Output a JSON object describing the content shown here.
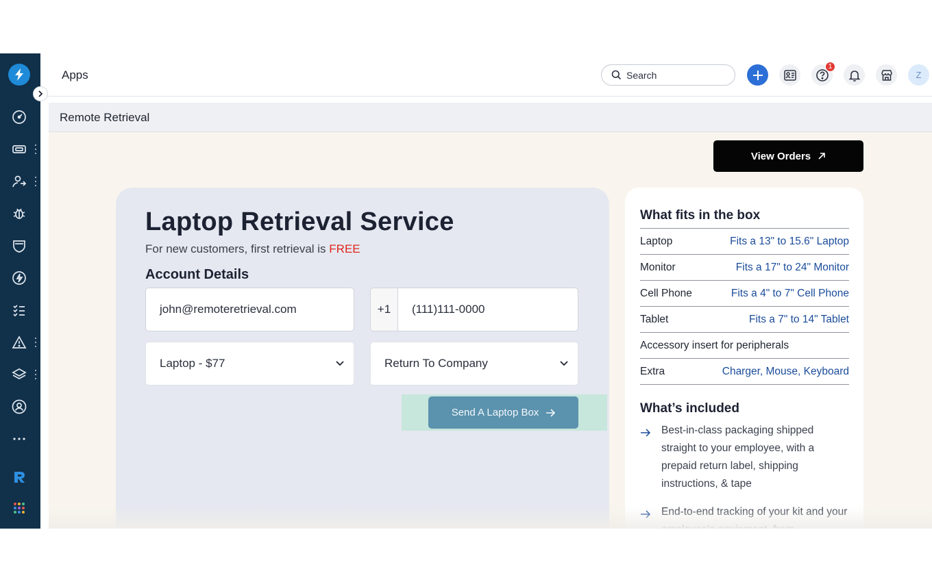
{
  "topbar": {
    "title": "Apps",
    "search_placeholder": "Search",
    "help_badge": "1",
    "avatar_initial": "Z"
  },
  "sidebar": {
    "items": [
      {
        "icon": "dashboard-icon"
      },
      {
        "icon": "ticket-icon",
        "more": true
      },
      {
        "icon": "contacts-icon",
        "more": true
      },
      {
        "icon": "bug-icon"
      },
      {
        "icon": "shield-icon"
      },
      {
        "icon": "lightning-icon"
      },
      {
        "icon": "checklist-icon"
      },
      {
        "icon": "alert-icon",
        "more": true
      },
      {
        "icon": "layers-icon",
        "more": true
      },
      {
        "icon": "admin-icon"
      },
      {
        "icon": "more-icon"
      },
      {
        "icon": "remote-retrieval-app-icon"
      },
      {
        "icon": "apps-grid-icon"
      }
    ]
  },
  "page": {
    "title": "Remote Retrieval",
    "view_orders_label": "View Orders"
  },
  "main_card": {
    "title": "Laptop Retrieval Service",
    "subtitle_prefix": "For new customers, first retrieval is",
    "subtitle_highlight": "FREE",
    "account_heading": "Account Details",
    "email_value": "john@remoteretrieval.com",
    "country_code": "+1",
    "phone_value": "(111)111-0000",
    "device_select": "Laptop - $77",
    "return_select": "Return To Company",
    "send_button": "Send A Laptop Box"
  },
  "side_card": {
    "fits_heading": "What fits in the box",
    "fits": [
      {
        "label": "Laptop",
        "value": "Fits a 13\" to 15.6\" Laptop"
      },
      {
        "label": "Monitor",
        "value": "Fits a 17\" to 24\" Monitor"
      },
      {
        "label": "Cell Phone",
        "value": "Fits a 4\" to 7\" Cell Phone"
      },
      {
        "label": "Tablet",
        "value": "Fits a 7\" to 14\" Tablet"
      },
      {
        "label": "Accessory insert for peripherals",
        "value": ""
      },
      {
        "label": "Extra",
        "value": "Charger, Mouse, Keyboard"
      }
    ],
    "included_heading": "What’s included",
    "included": [
      "Best-in-class packaging shipped straight to your employee, with a prepaid return label, shipping instructions, & tape",
      "End-to-end tracking of your kit and your employee's equipment, from"
    ]
  },
  "colors": {
    "sidebar_bg": "#11304a",
    "accent_blue": "#2c6fd6",
    "free_red": "#e0241b",
    "link_blue": "#1b4c9a",
    "send_button": "#5b92ae"
  }
}
